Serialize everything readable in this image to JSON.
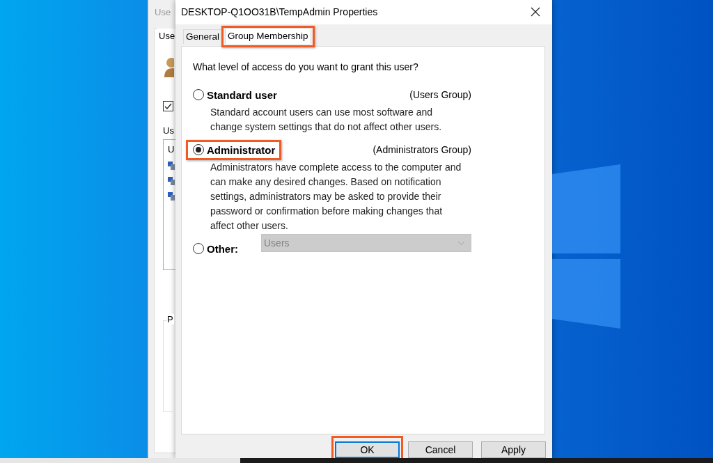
{
  "background_window": {
    "title": "Use",
    "tab": "Use",
    "checkbox": {
      "checked": true
    },
    "label": "Us",
    "list_item": "U",
    "group_label": "P"
  },
  "dialog": {
    "title": "DESKTOP-Q1OO31B\\TempAdmin Properties",
    "tabs": [
      {
        "label": "General",
        "selected": false,
        "highlighted": false
      },
      {
        "label": "Group Membership",
        "selected": true,
        "highlighted": true
      }
    ],
    "prompt": "What level of access do you want to grant this user?",
    "options": [
      {
        "kind": "text",
        "label": "Standard user",
        "group": "(Users Group)",
        "description": "Standard account users can use most software and change system settings that do not affect other users.",
        "selected": false,
        "highlighted": false
      },
      {
        "kind": "text",
        "label": "Administrator",
        "group": "(Administrators Group)",
        "description": "Administrators have complete access to the computer and can make any desired changes. Based on notification settings, administrators may be asked to provide their password or confirmation before making changes that affect other users.",
        "selected": true,
        "highlighted": true
      },
      {
        "kind": "dropdown",
        "label": "Other:",
        "value": "Users",
        "disabled": true,
        "selected": false,
        "highlighted": false
      }
    ],
    "buttons": [
      {
        "label": "OK",
        "default": true,
        "highlighted": true
      },
      {
        "label": "Cancel",
        "default": false,
        "highlighted": false
      },
      {
        "label": "Apply",
        "default": false,
        "highlighted": false
      }
    ]
  }
}
